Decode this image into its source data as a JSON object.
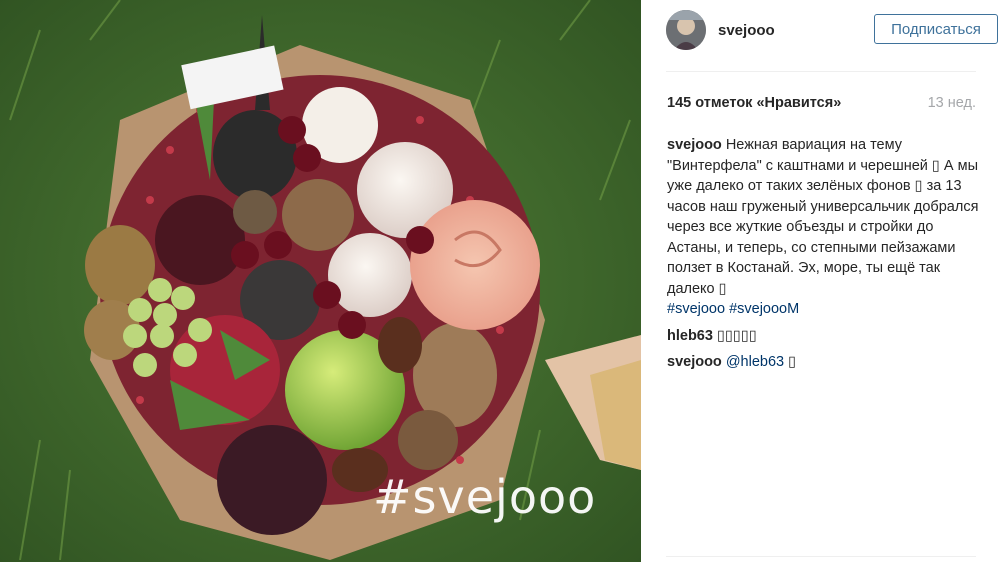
{
  "post": {
    "image": {
      "description_hidden": "",
      "watermark": "#svejooo"
    },
    "header": {
      "username": "svejooo",
      "follow_label": "Подписаться"
    },
    "likes": "145 отметок «Нравится»",
    "time": "13 нед.",
    "caption": {
      "user": "svejooo",
      "text": "Нежная вариация на тему \"Винтерфела\" с каштнами и черешней",
      "box1": "▯",
      "text2": "А мы уже далеко от таких зелёных фонов",
      "box2": "▯",
      "text3": "за 13 часов наш груженый универсальчик добрался через все жуткие объезды и стройки до Астаны, и теперь, со степными пейзажами ползет в Костанай. Эх, море, ты ещё так далеко",
      "box3": "▯"
    },
    "hashtags": [
      "#svejooo",
      "#svejoooM"
    ],
    "comments": [
      {
        "user": "hleb63",
        "text": "▯▯▯▯▯"
      },
      {
        "user": "svejooo",
        "mention": "@hleb63",
        "text": "▯"
      }
    ],
    "colors": {
      "accent": "#3f729b",
      "link": "#003569",
      "muted": "#a5a7aa"
    }
  }
}
